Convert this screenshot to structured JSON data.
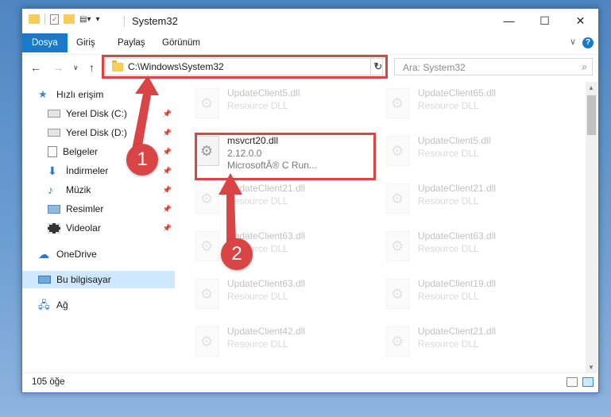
{
  "window": {
    "title": "System32",
    "controls": {
      "minimize": "—",
      "maximize": "☐",
      "close": "✕"
    }
  },
  "ribbon": {
    "tabs": [
      "Dosya",
      "Giriş",
      "Paylaş",
      "Görünüm"
    ],
    "help": "?"
  },
  "address_bar": {
    "path": "C:\\Windows\\System32",
    "search_placeholder": "Ara: System32"
  },
  "nav_pane": {
    "quick_access_label": "Hızlı erişim",
    "quick_items": [
      {
        "label": "Yerel Disk (C:)",
        "icon": "drive-icon"
      },
      {
        "label": "Yerel Disk (D:)",
        "icon": "drive-icon"
      },
      {
        "label": "Belgeler",
        "icon": "documents-icon"
      },
      {
        "label": "İndirmeler",
        "icon": "downloads-icon"
      },
      {
        "label": "Müzik",
        "icon": "music-icon"
      },
      {
        "label": "Resimler",
        "icon": "pictures-icon"
      },
      {
        "label": "Videolar",
        "icon": "videos-icon"
      }
    ],
    "onedrive": "OneDrive",
    "this_pc": "Bu bilgisayar",
    "network": "Ağ"
  },
  "files": {
    "highlighted": {
      "name": "msvcrt20.dll",
      "version": "2.12.0.0",
      "company": "MicrosoftÂ® C Run..."
    },
    "background": [
      {
        "name": "UpdateClient5.dll",
        "type": "Resource DLL"
      },
      {
        "name": "UpdateClient65.dll",
        "type": "Resource DLL"
      },
      {
        "name": "UpdateClient5.dll",
        "type": "Resource DLL"
      },
      {
        "name": "UpdateClient21.dll",
        "type": "Resource DLL"
      },
      {
        "name": "UpdateClient21.dll",
        "type": "Resource DLL"
      },
      {
        "name": "UpdateClient63.dll",
        "type": "Resource DLL"
      },
      {
        "name": "UpdateClient63.dll",
        "type": "Resource DLL"
      },
      {
        "name": "UpdateClient63.dll",
        "type": "Resource DLL"
      },
      {
        "name": "UpdateClient19.dll",
        "type": "Resource DLL"
      },
      {
        "name": "UpdateClient42.dll",
        "type": "Resource DLL"
      },
      {
        "name": "UpdateClient21.dll",
        "type": "Resource DLL"
      }
    ]
  },
  "status_bar": {
    "item_count": "105 öğe"
  },
  "annotations": {
    "step1": "1",
    "step2": "2"
  },
  "colors": {
    "accent": "#1979ca",
    "highlight": "#d94545",
    "selection": "#cde8ff"
  }
}
